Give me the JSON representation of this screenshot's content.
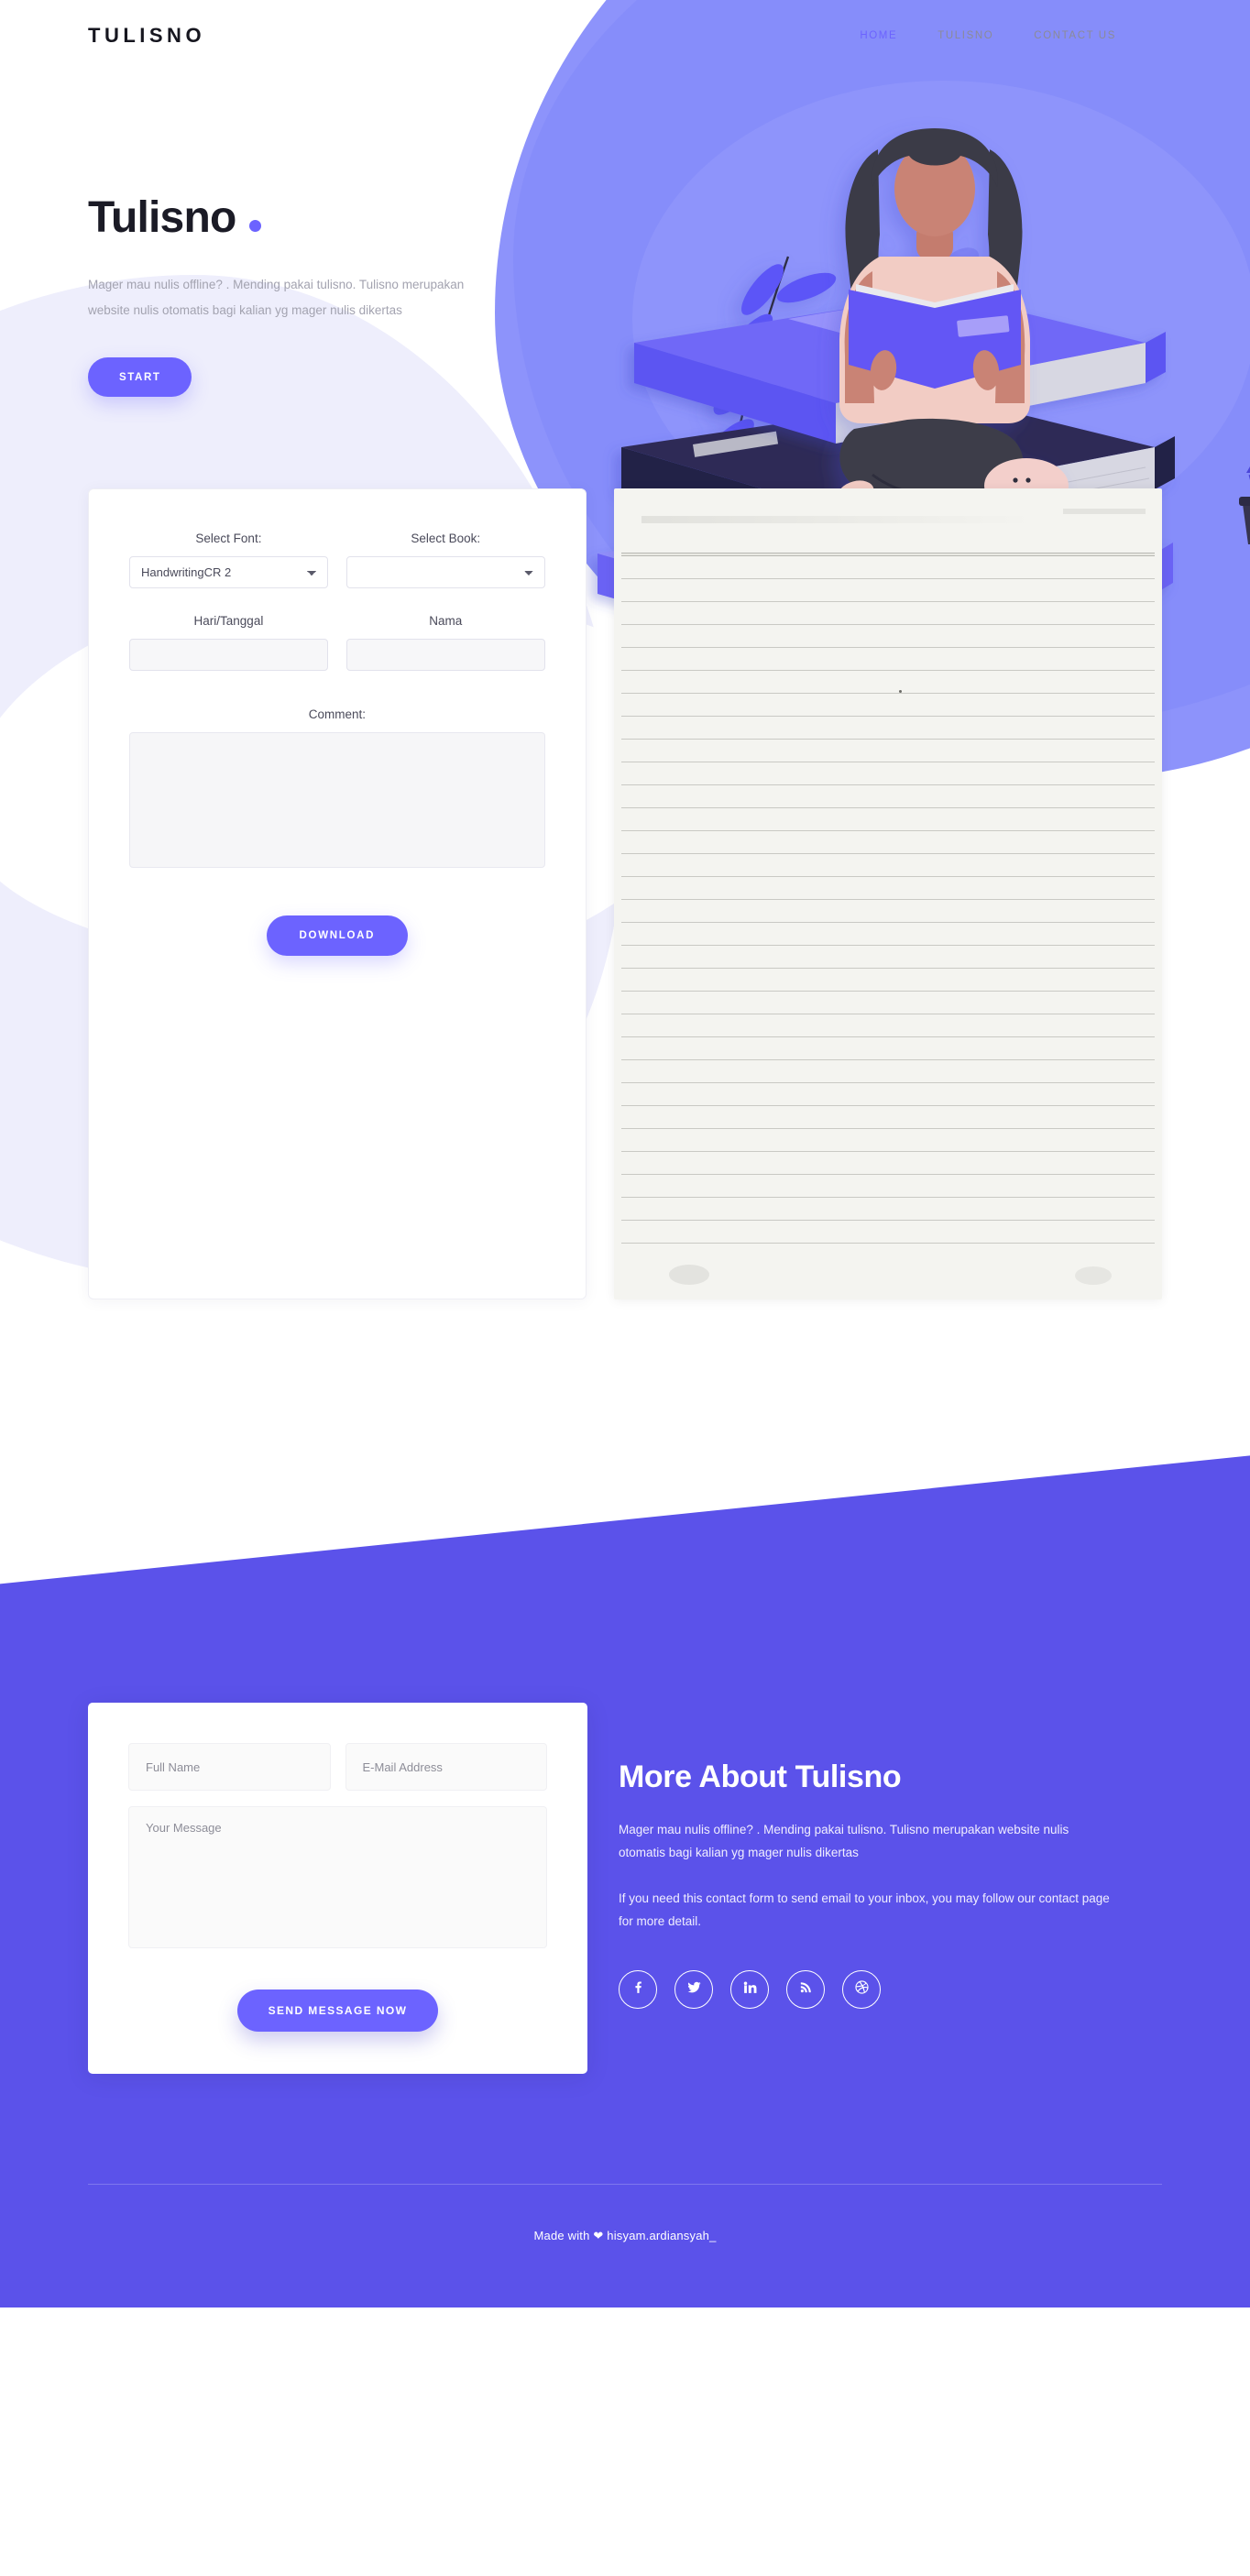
{
  "header": {
    "brand": "TULISNO",
    "nav": [
      {
        "label": "HOME",
        "active": true
      },
      {
        "label": "TULISNO",
        "active": false
      },
      {
        "label": "CONTACT US",
        "active": false
      }
    ]
  },
  "hero": {
    "title": "Tulisno",
    "description": "Mager mau nulis offline? . Mending pakai tulisno. Tulisno merupakan website nulis otomatis bagi kalian yg mager nulis dikertas",
    "cta_label": "START"
  },
  "tool": {
    "select_font_label": "Select Font:",
    "select_font_value": "HandwritingCR 2",
    "select_book_label": "Select Book:",
    "select_book_value": "",
    "hari_tanggal_label": "Hari/Tanggal",
    "hari_tanggal_value": "",
    "nama_label": "Nama",
    "nama_value": "",
    "comment_label": "Comment:",
    "comment_value": "",
    "download_label": "DOWNLOAD"
  },
  "contact": {
    "full_name_placeholder": "Full Name",
    "email_placeholder": "E-Mail Address",
    "message_placeholder": "Your Message",
    "send_label": "SEND MESSAGE NOW"
  },
  "about": {
    "title": "More About Tulisno",
    "paragraph1": "Mager mau nulis offline? . Mending pakai tulisno. Tulisno merupakan website nulis otomatis bagi kalian yg mager nulis dikertas",
    "paragraph2": "If you need this contact form to send email to your inbox, you may follow our contact page for more detail.",
    "socials": [
      {
        "name": "facebook"
      },
      {
        "name": "twitter"
      },
      {
        "name": "linkedin"
      },
      {
        "name": "rss"
      },
      {
        "name": "dribbble"
      }
    ]
  },
  "footer": {
    "prefix": "Made with ",
    "heart": "❤",
    "suffix": " hisyam.ardiansyah_"
  },
  "colors": {
    "accent": "#6c63ff",
    "contact_bg": "#5b52ea",
    "hero_blob": "#8d93fb",
    "lilac": "#eeeefc",
    "text_dark": "#1b1b26",
    "text_muted": "#a3a3b0"
  }
}
